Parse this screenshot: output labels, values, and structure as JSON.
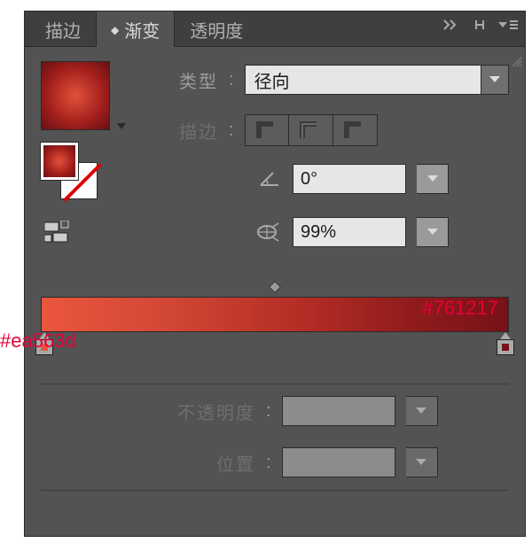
{
  "tabs": {
    "stroke": "描边",
    "gradient": "渐变",
    "transparency": "透明度"
  },
  "labels": {
    "type": "类型",
    "stroke": "描边",
    "opacity": "不透明度",
    "position": "位置"
  },
  "type_value": "径向",
  "angle_value": "0°",
  "aspect_value": "99%",
  "opacity_value": "",
  "position_value": "",
  "gradient": {
    "start": "#ea563d",
    "end": "#761217"
  },
  "annotations": {
    "left": "#ea563d",
    "right": "#761217"
  },
  "dirty": "◆"
}
